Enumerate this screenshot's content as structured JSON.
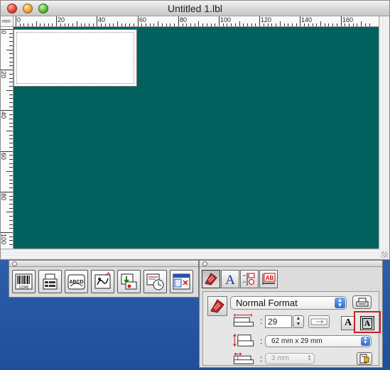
{
  "window": {
    "title": "Untitled 1.lbl",
    "ruler_unit": "mm",
    "ruler_h_numbers": [
      "0",
      "20",
      "40",
      "60",
      "80",
      "100",
      "120",
      "140",
      "160"
    ],
    "ruler_v_numbers": [
      "0",
      "20",
      "40",
      "60",
      "80",
      "100"
    ],
    "canvas_color": "#02605f"
  },
  "tools_palette": {
    "tools": [
      {
        "name": "barcode-tool",
        "icon": "barcode-icon",
        "text": "12345"
      },
      {
        "name": "database-tool",
        "icon": "database-icon"
      },
      {
        "name": "text-arrange-tool",
        "icon": "arc-text-icon",
        "text": "ABCD"
      },
      {
        "name": "clipart-tool",
        "icon": "clipart-icon"
      },
      {
        "name": "image-tool",
        "icon": "image-icon"
      },
      {
        "name": "date-time-tool",
        "icon": "clock-icon"
      },
      {
        "name": "layout-tool",
        "icon": "layout-icon"
      }
    ]
  },
  "properties_palette": {
    "tabs": [
      {
        "name": "page-tab",
        "icon": "tape-icon",
        "active": true
      },
      {
        "name": "font-tab",
        "icon": "font-a-icon",
        "glyph": "A"
      },
      {
        "name": "layout-tab",
        "icon": "align-icon"
      },
      {
        "name": "text-tab",
        "icon": "text-ab-icon",
        "glyph": "AB"
      }
    ],
    "format": {
      "selected": "Normal Format"
    },
    "length": {
      "value": "29"
    },
    "media_size": {
      "selected": "62 mm x 29 mm"
    },
    "margin": {
      "selected": "3 mm",
      "disabled": true
    },
    "font_buttons": [
      {
        "glyph": "A",
        "pressed": false
      },
      {
        "glyph": "A",
        "pressed": true
      }
    ],
    "highlight_color": "#d01f1f"
  }
}
